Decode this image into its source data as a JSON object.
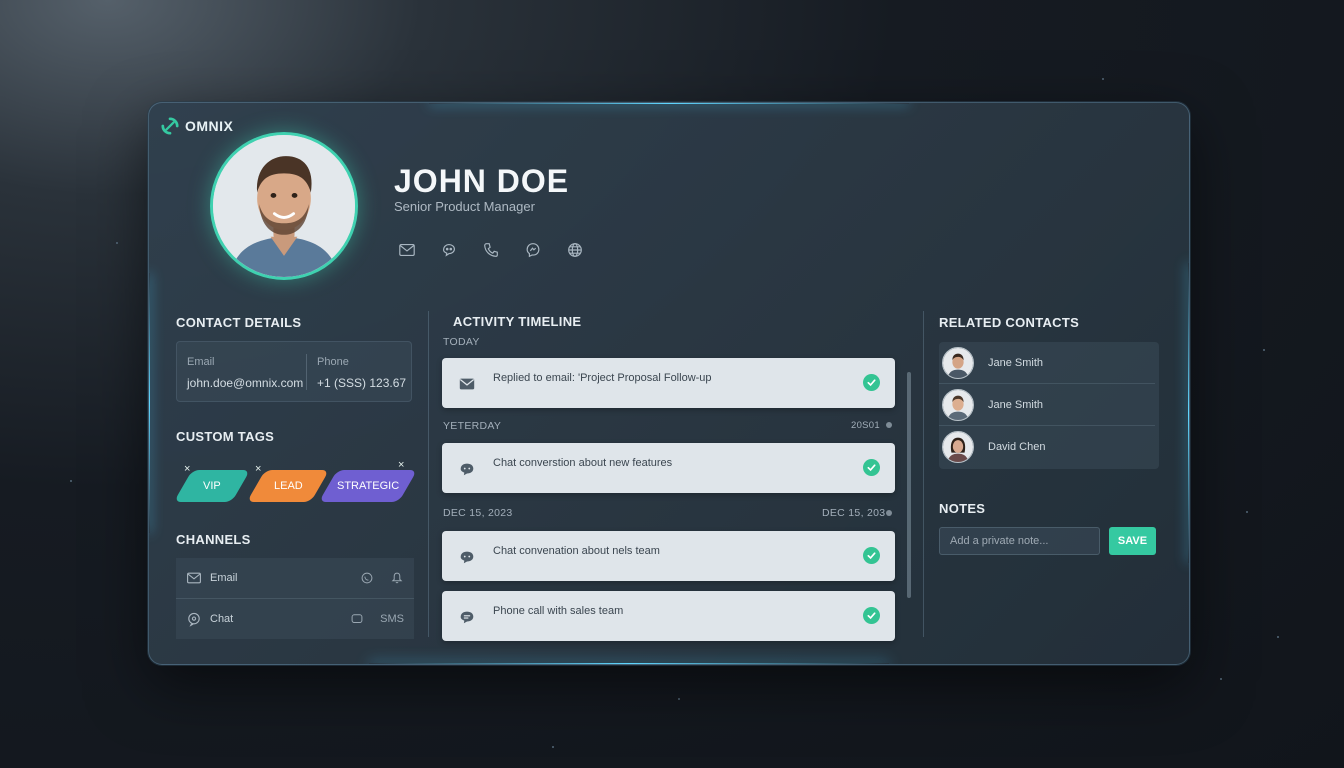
{
  "brand": {
    "name": "OMNIX",
    "accent": "#35c9a1"
  },
  "profile": {
    "name": "JOHN DOE",
    "title": "Senior Product Manager",
    "social_icons": [
      "mail-icon",
      "chat-icon",
      "phone-icon",
      "messenger-icon",
      "globe-icon"
    ]
  },
  "contact_details": {
    "heading": "CONTACT DETAILS",
    "email_label": "Email",
    "email_value": "john.doe@omnix.com",
    "phone_label": "Phone",
    "phone_value": "+1 (SSS) 123.67"
  },
  "custom_tags": {
    "heading": "CUSTOM TAGS",
    "tags": [
      {
        "label": "VIP",
        "color": "#2fb5a2"
      },
      {
        "label": "LEAD",
        "color": "#f08a3a"
      },
      {
        "label": "STRATEGIC",
        "color": "#6f5fd1"
      }
    ],
    "remove_glyph": "×"
  },
  "channels": {
    "heading": "CHANNELS",
    "rows": [
      {
        "label": "Email",
        "right_text": ""
      },
      {
        "label": "Chat",
        "right_text": "SMS"
      }
    ]
  },
  "timeline": {
    "heading": "ACTIVITY TIMELINE",
    "groups": [
      {
        "label": "TODAY",
        "right": ""
      },
      {
        "label": "YETERDAY",
        "right": "20S01"
      },
      {
        "label": "DEC 15, 2023",
        "right": "DEC 15, 203"
      }
    ],
    "items": [
      {
        "text": "Replied to email: 'Project Proposal Follow-up",
        "icon": "mail-icon"
      },
      {
        "text": "Chat converstion about new features",
        "icon": "chat-icon"
      },
      {
        "text": "Chat convenation about nels team",
        "icon": "chat-icon"
      },
      {
        "text": "Phone call with sales team",
        "icon": "chat-icon"
      }
    ]
  },
  "related": {
    "heading": "RELATED CONTACTS",
    "contacts": [
      "Jane Smith",
      "Jane Smith",
      "David Chen"
    ]
  },
  "notes": {
    "heading": "NOTES",
    "placeholder": "Add a private note...",
    "save_label": "SAVE"
  }
}
